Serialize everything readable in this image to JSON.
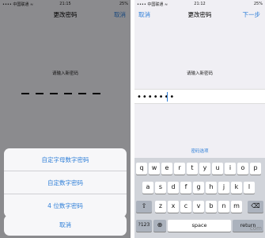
{
  "left": {
    "status": {
      "carrier": "•••• 中国联通 ≈",
      "time": "21:15",
      "battery": "25%"
    },
    "nav": {
      "title": "更改密码",
      "right": "取消"
    },
    "prompt": "请输入新密码",
    "sheet": {
      "items": [
        "自定字母数字密码",
        "自定数字密码",
        "4 位数字密码"
      ],
      "cancel": "取消"
    }
  },
  "right": {
    "status": {
      "carrier": "•••• 中国联通 ≈",
      "time": "21:12",
      "battery": "25%"
    },
    "nav": {
      "left": "取消",
      "title": "更改密码",
      "right": "下一步"
    },
    "prompt": "请输入新密码",
    "password_value": "•••••••",
    "options_link": "密码选项",
    "keyboard": {
      "row1": [
        "q",
        "w",
        "e",
        "r",
        "t",
        "y",
        "u",
        "i",
        "o",
        "p"
      ],
      "row2": [
        "a",
        "s",
        "d",
        "f",
        "g",
        "h",
        "j",
        "k",
        "l"
      ],
      "row3": [
        "z",
        "x",
        "c",
        "v",
        "b",
        "n",
        "m"
      ],
      "shift": "⇧",
      "delete": "⌫",
      "numbers": "?123",
      "globe": "⊕",
      "space": "space",
      "return": "return"
    },
    "watermark": "com"
  }
}
